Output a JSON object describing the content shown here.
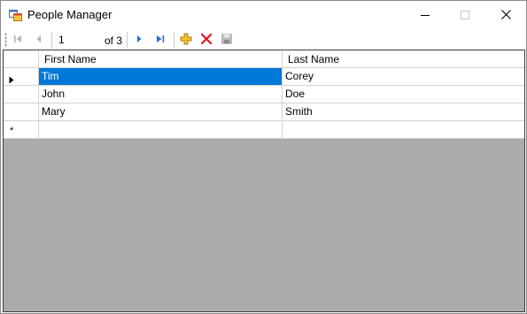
{
  "window": {
    "title": "People Manager",
    "icons": {
      "app": "app-window-icon",
      "minimize": "minimize-icon",
      "maximize": "maximize-icon",
      "close": "close-icon"
    }
  },
  "navigator": {
    "position": "1",
    "count_label": "of 3",
    "icons": {
      "move_first": "move-first-icon",
      "move_previous": "move-previous-icon",
      "move_next": "move-next-icon",
      "move_last": "move-last-icon",
      "add_new": "add-new-icon",
      "delete": "delete-icon",
      "save": "save-icon"
    },
    "colors": {
      "nav_blue": "#1e6ed6",
      "nav_disabled": "#b4b4b4",
      "add_gold": "#e8b000",
      "delete_red": "#e81123"
    }
  },
  "grid": {
    "columns": [
      "First Name",
      "Last Name"
    ],
    "rows": [
      {
        "first_name": "Tim",
        "last_name": "Corey",
        "selected": true
      },
      {
        "first_name": "John",
        "last_name": "Doe",
        "selected": false
      },
      {
        "first_name": "Mary",
        "last_name": "Smith",
        "selected": false
      }
    ],
    "new_row_marker": "*",
    "colors": {
      "selection": "#0078d7",
      "background": "#ababab"
    }
  }
}
